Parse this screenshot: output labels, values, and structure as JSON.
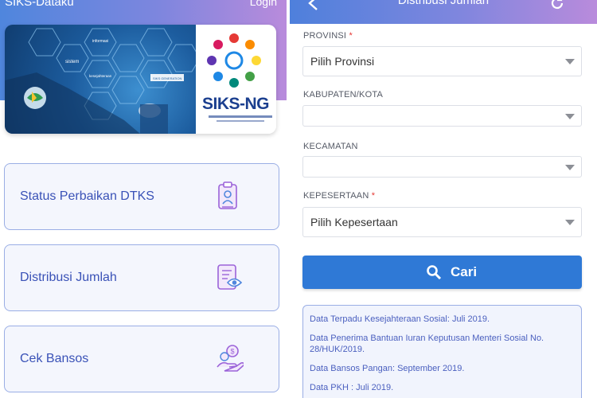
{
  "left": {
    "app_title": "SIKS-Dataku",
    "login_label": "Login",
    "banner": {
      "words": [
        "informasi",
        "sistem",
        "kesejahteraan",
        "SIKS GENERATION"
      ],
      "logo_text": "SIKS-NG"
    },
    "menu": [
      {
        "label": "Status Perbaikan DTKS",
        "icon": "clipboard-id-icon"
      },
      {
        "label": "Distribusi Jumlah",
        "icon": "document-eye-icon"
      },
      {
        "label": "Cek Bansos",
        "icon": "hand-coin-icon"
      }
    ]
  },
  "right": {
    "title": "Distribusi Jumlah",
    "fields": [
      {
        "label": "PROVINSI",
        "required": "*",
        "value": "Pilih Provinsi"
      },
      {
        "label": "KABUPATEN/KOTA",
        "required": "",
        "value": ""
      },
      {
        "label": "KECAMATAN",
        "required": "",
        "value": ""
      },
      {
        "label": "KEPESERTAAN",
        "required": "*",
        "value": "Pilih Kepesertaan"
      }
    ],
    "search_button": "Cari",
    "info_lines": [
      "Data Terpadu Kesejahteraan Sosial: Juli 2019.",
      "Data Penerima Bantuan Iuran Keputusan Menteri Sosial No. 28/HUK/2019.",
      "Data Bansos Pangan: September 2019.",
      "Data PKH : Juli 2019."
    ]
  },
  "colors": {
    "header_gradient_start": "#4f86dd",
    "header_gradient_end": "#b98bdc",
    "accent_blue": "#2f79d6",
    "card_border": "#9aaee5",
    "card_text": "#3a52b7",
    "required_red": "#e53935"
  }
}
